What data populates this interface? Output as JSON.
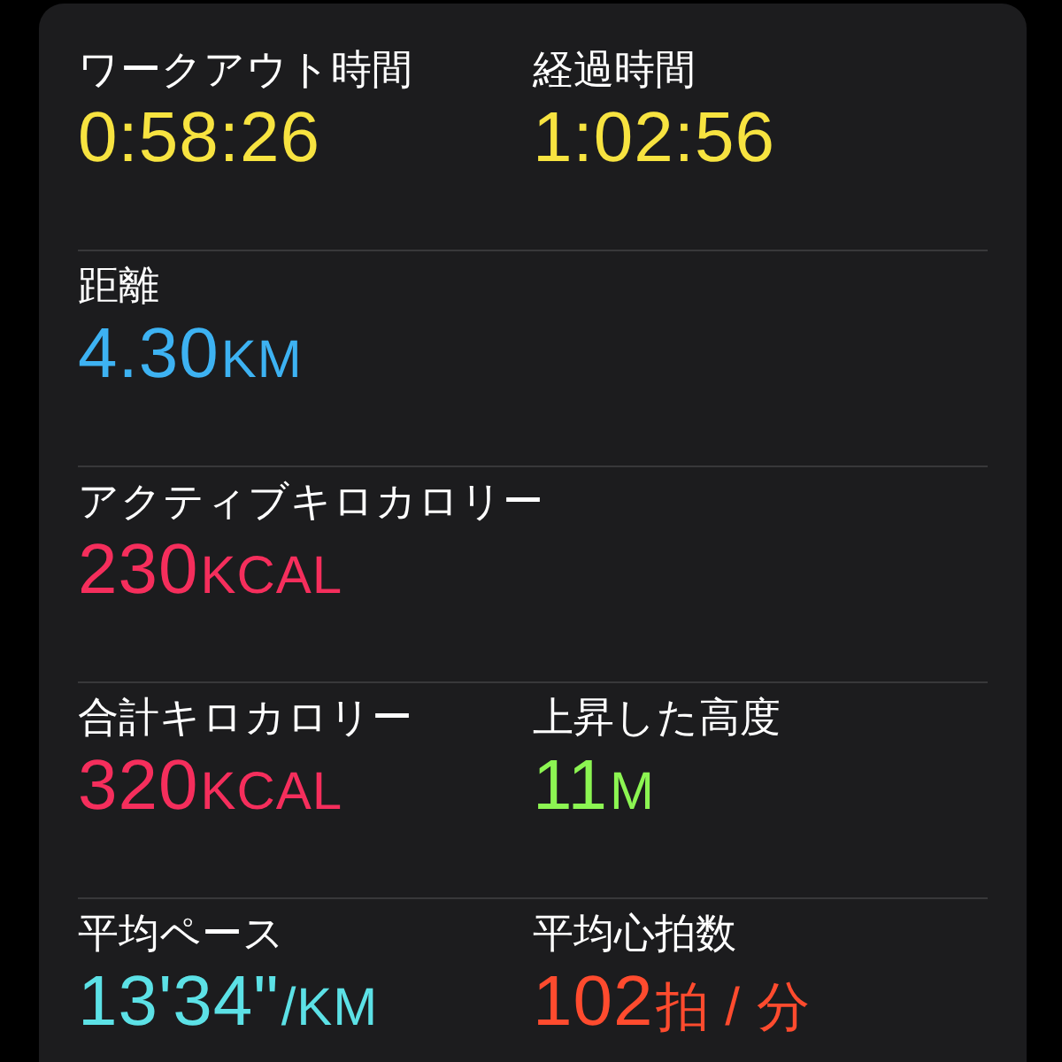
{
  "rows": [
    {
      "metrics": [
        {
          "label": "ワークアウト時間",
          "value": "0:58:26",
          "color": "#f7e340"
        },
        {
          "label": "経過時間",
          "value": "1:02:56",
          "color": "#f7e340"
        }
      ]
    },
    {
      "metrics": [
        {
          "label": "距離",
          "value": "4.30",
          "unit": "KM",
          "color": "#3db2f2"
        }
      ]
    },
    {
      "metrics": [
        {
          "label": "アクティブキロカロリー",
          "value": "230",
          "unit": "KCAL",
          "color": "#f52e5c"
        }
      ]
    },
    {
      "metrics": [
        {
          "label": "合計キロカロリー",
          "value": "320",
          "unit": "KCAL",
          "color": "#f52e5c"
        },
        {
          "label": "上昇した高度",
          "value": "11",
          "unit": "M",
          "color": "#8cf552"
        }
      ]
    },
    {
      "metrics": [
        {
          "label": "平均ペース",
          "value": "13'34\"",
          "unit": "/KM",
          "color": "#5ce1e6"
        },
        {
          "label": "平均心拍数",
          "value": "102",
          "unit": "拍 / 分",
          "color": "#ff4b2e"
        }
      ]
    }
  ]
}
